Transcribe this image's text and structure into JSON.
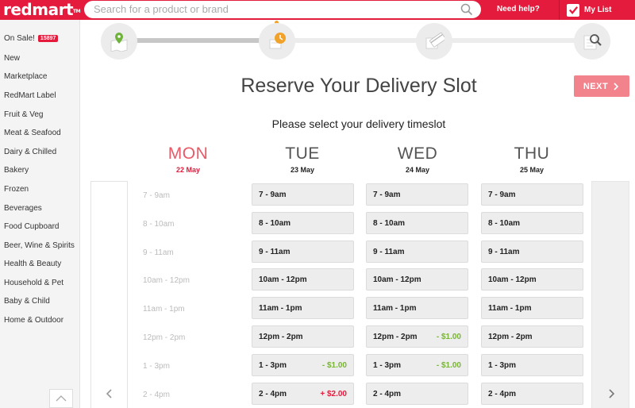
{
  "header": {
    "logo": "redmart",
    "logo_tm": "TM",
    "search_placeholder": "Search for a product or brand",
    "help_label": "Need help?",
    "mylist_label": "My List"
  },
  "sidebar": {
    "sale_label": "On Sale!",
    "sale_count": "15897",
    "items": [
      "New",
      "Marketplace",
      "RedMart Label",
      "Fruit & Veg",
      "Meat & Seafood",
      "Dairy & Chilled",
      "Bakery",
      "Frozen",
      "Beverages",
      "Food Cupboard",
      "Beer, Wine & Spirits",
      "Health & Beauty",
      "Household & Pet",
      "Baby & Child",
      "Home & Outdoor"
    ]
  },
  "progress": {
    "steps": [
      "location-pin-icon",
      "delivery-clock-icon",
      "payment-card-icon",
      "review-search-icon"
    ],
    "current_step": 2
  },
  "main": {
    "title": "Reserve Your Delivery Slot",
    "next_label": "NEXT",
    "subtitle": "Please select your delivery timeslot"
  },
  "days": [
    {
      "name": "MON",
      "date": "22 May"
    },
    {
      "name": "TUE",
      "date": "23 May"
    },
    {
      "name": "WED",
      "date": "24 May"
    },
    {
      "name": "THU",
      "date": "25 May"
    }
  ],
  "time_labels": [
    "7 - 9am",
    "8 - 10am",
    "9 - 11am",
    "10am - 12pm",
    "11am - 1pm",
    "12pm - 2pm",
    "1 - 3pm",
    "2 - 4pm"
  ],
  "slots": {
    "tue": [
      {
        "time": "7 - 9am",
        "fee": ""
      },
      {
        "time": "8 - 10am",
        "fee": ""
      },
      {
        "time": "9 - 11am",
        "fee": ""
      },
      {
        "time": "10am - 12pm",
        "fee": ""
      },
      {
        "time": "11am - 1pm",
        "fee": ""
      },
      {
        "time": "12pm - 2pm",
        "fee": ""
      },
      {
        "time": "1 - 3pm",
        "fee": "- $1.00"
      },
      {
        "time": "2 - 4pm",
        "fee": "+ $2.00"
      }
    ],
    "wed": [
      {
        "time": "7 - 9am",
        "fee": ""
      },
      {
        "time": "8 - 10am",
        "fee": ""
      },
      {
        "time": "9 - 11am",
        "fee": ""
      },
      {
        "time": "10am - 12pm",
        "fee": ""
      },
      {
        "time": "11am - 1pm",
        "fee": ""
      },
      {
        "time": "12pm - 2pm",
        "fee": "- $1.00"
      },
      {
        "time": "1 - 3pm",
        "fee": "- $1.00"
      },
      {
        "time": "2 - 4pm",
        "fee": ""
      }
    ],
    "thu": [
      {
        "time": "7 - 9am",
        "fee": ""
      },
      {
        "time": "8 - 10am",
        "fee": ""
      },
      {
        "time": "9 - 11am",
        "fee": ""
      },
      {
        "time": "10am - 12pm",
        "fee": ""
      },
      {
        "time": "11am - 1pm",
        "fee": ""
      },
      {
        "time": "12pm - 2pm",
        "fee": ""
      },
      {
        "time": "1 - 3pm",
        "fee": ""
      },
      {
        "time": "2 - 4pm",
        "fee": ""
      }
    ]
  },
  "colors": {
    "brand": "#e41b3c",
    "discount": "#7ab33a",
    "surcharge": "#e41b3c"
  }
}
